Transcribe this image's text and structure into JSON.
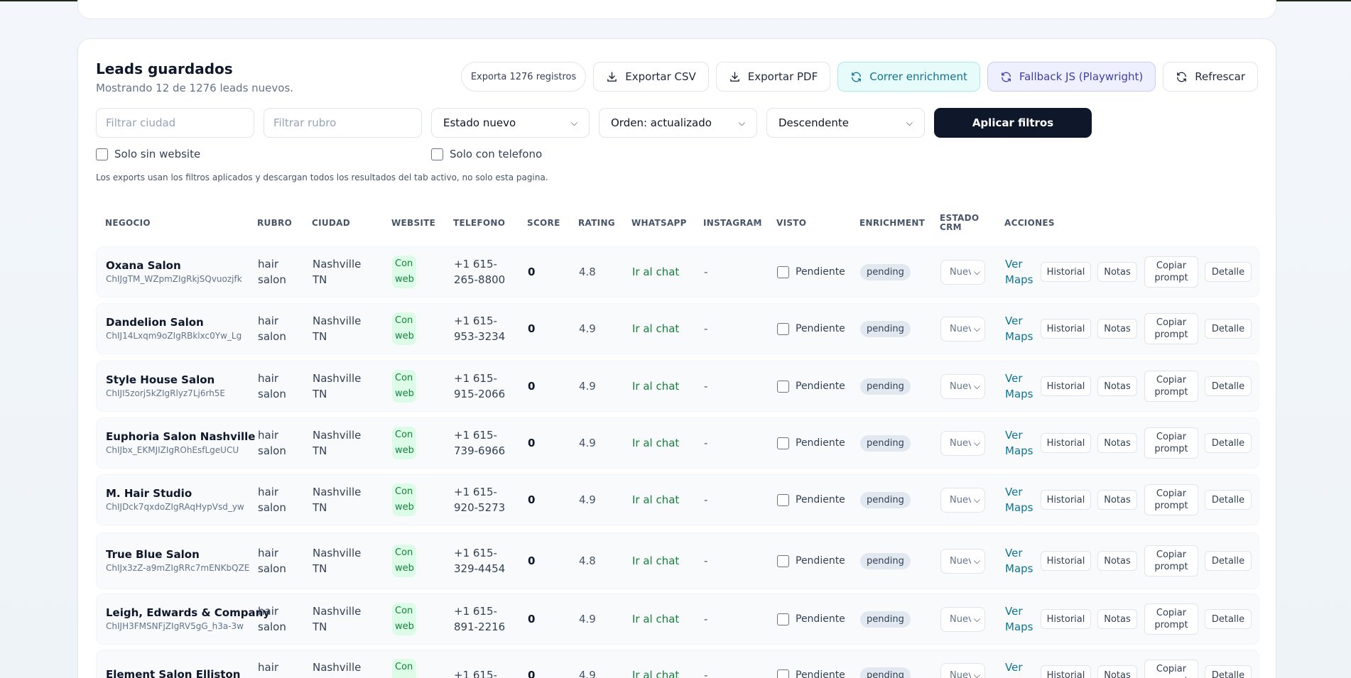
{
  "section": {
    "title": "Leads guardados",
    "subtitle": "Mostrando 12 de 1276 leads nuevos.",
    "export_count": "Exporta 1276 registros",
    "note": "Los exports usan los filtros aplicados y descargan todos los resultados del tab activo, no solo esta pagina."
  },
  "toolbar": {
    "export_csv": "Exportar CSV",
    "export_pdf": "Exportar PDF",
    "run_enrichment": "Correr enrichment",
    "fallback_js": "Fallback JS (Playwright)",
    "refresh": "Refrescar"
  },
  "filters": {
    "city_placeholder": "Filtrar ciudad",
    "category_placeholder": "Filtrar rubro",
    "status": "Estado nuevo",
    "order": "Orden: actualizado",
    "direction": "Descendente",
    "apply": "Aplicar filtros",
    "only_no_website": "Solo sin website",
    "only_with_phone": "Solo con telefono"
  },
  "columns": {
    "negocio": "NEGOCIO",
    "rubro": "RUBRO",
    "ciudad": "CIUDAD",
    "website": "WEBSITE",
    "telefono": "TELEFONO",
    "score": "SCORE",
    "rating": "RATING",
    "whatsapp": "WHATSAPP",
    "instagram": "INSTAGRAM",
    "visto": "VISTO",
    "enrichment": "ENRICHMENT",
    "estado_crm_1": "ESTADO",
    "estado_crm_2": "CRM",
    "acciones": "ACCIONES"
  },
  "labels": {
    "rubro_1": "hair",
    "rubro_2": "salon",
    "ciudad_1": "Nashville",
    "ciudad_2": "TN",
    "web_1": "Con",
    "web_2": "web",
    "whatsapp": "Ir al chat",
    "instagram": "-",
    "visto": "Pendiente",
    "enrichment": "pending",
    "crm": "Nuevo",
    "maps_1": "Ver",
    "maps_2": "Maps",
    "historial": "Historial",
    "notas": "Notas",
    "copiar_1": "Copiar",
    "copiar_2": "prompt",
    "detalle": "Detalle"
  },
  "rows": [
    {
      "name": "Oxana Salon",
      "id": "ChIJgTM_WZpmZIgRkjSQvuozjfk",
      "phone_1": "+1 615-",
      "phone_2": "265-8800",
      "score": "0",
      "rating": "4.8"
    },
    {
      "name": "Dandelion Salon",
      "id": "ChIJ14Lxqm9oZIgRBklxc0Yw_Lg",
      "phone_1": "+1 615-",
      "phone_2": "953-3234",
      "score": "0",
      "rating": "4.9"
    },
    {
      "name": "Style House Salon",
      "id": "ChIJI5zorj5kZIgRlyz7Lj6rh5E",
      "phone_1": "+1 615-",
      "phone_2": "915-2066",
      "score": "0",
      "rating": "4.9"
    },
    {
      "name": "Euphoria Salon Nashville",
      "id": "ChIJbx_EKMJIZIgROhEsfLgeUCU",
      "phone_1": "+1 615-",
      "phone_2": "739-6966",
      "score": "0",
      "rating": "4.9"
    },
    {
      "name": "M. Hair Studio",
      "id": "ChIJDck7qxdoZIgRAqHypVsd_yw",
      "phone_1": "+1 615-",
      "phone_2": "920-5273",
      "score": "0",
      "rating": "4.9"
    },
    {
      "name": "True Blue Salon",
      "id": "ChIJx3zZ-a9mZIgRRc7mENKbQZE",
      "phone_1": "+1 615-",
      "phone_2": "329-4454",
      "score": "0",
      "rating": "4.8"
    },
    {
      "name": "Leigh, Edwards & Company",
      "id": "ChIJH3FMSNFjZIgRV5gG_h3a-3w",
      "phone_1": "+1 615-",
      "phone_2": "891-2216",
      "score": "0",
      "rating": "4.9"
    },
    {
      "name": "Element Salon Elliston",
      "id": "",
      "phone_1": "+1 615-",
      "phone_2": "",
      "score": "0",
      "rating": "4.9"
    }
  ]
}
